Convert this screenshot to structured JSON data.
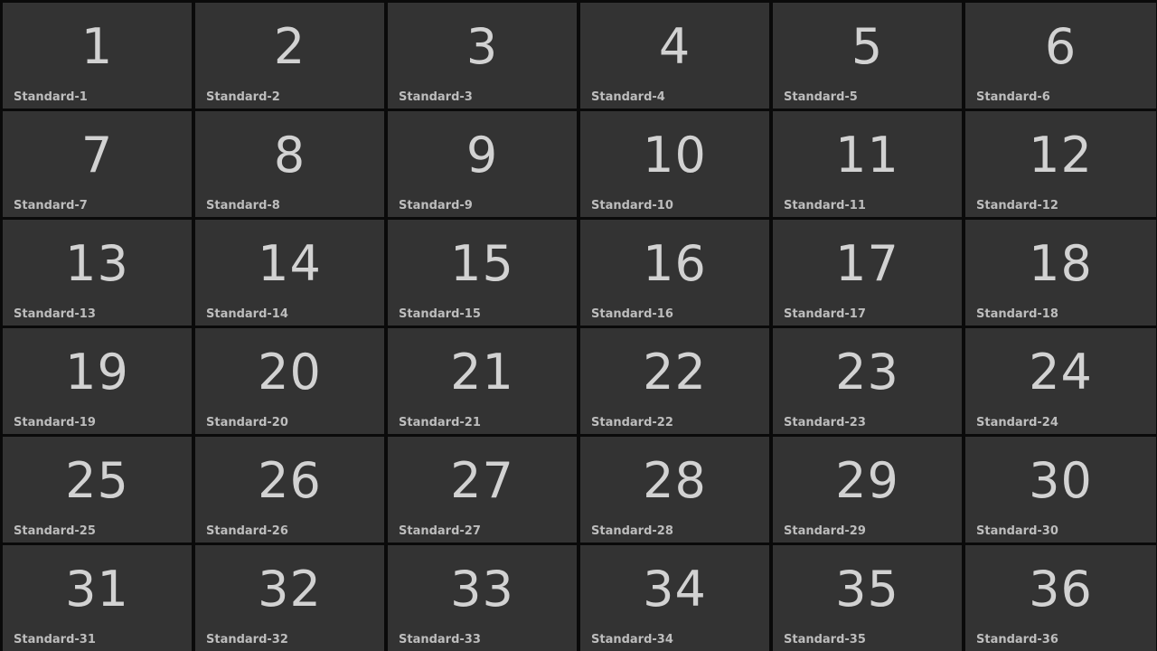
{
  "colors": {
    "background": "#0a0a0a",
    "tile": "#333333",
    "number_text": "#d2d2d2",
    "label_text": "#bdbdbd"
  },
  "tiles": [
    {
      "number": "1",
      "label": "Standard-1"
    },
    {
      "number": "2",
      "label": "Standard-2"
    },
    {
      "number": "3",
      "label": "Standard-3"
    },
    {
      "number": "4",
      "label": "Standard-4"
    },
    {
      "number": "5",
      "label": "Standard-5"
    },
    {
      "number": "6",
      "label": "Standard-6"
    },
    {
      "number": "7",
      "label": "Standard-7"
    },
    {
      "number": "8",
      "label": "Standard-8"
    },
    {
      "number": "9",
      "label": "Standard-9"
    },
    {
      "number": "10",
      "label": "Standard-10"
    },
    {
      "number": "11",
      "label": "Standard-11"
    },
    {
      "number": "12",
      "label": "Standard-12"
    },
    {
      "number": "13",
      "label": "Standard-13"
    },
    {
      "number": "14",
      "label": "Standard-14"
    },
    {
      "number": "15",
      "label": "Standard-15"
    },
    {
      "number": "16",
      "label": "Standard-16"
    },
    {
      "number": "17",
      "label": "Standard-17"
    },
    {
      "number": "18",
      "label": "Standard-18"
    },
    {
      "number": "19",
      "label": "Standard-19"
    },
    {
      "number": "20",
      "label": "Standard-20"
    },
    {
      "number": "21",
      "label": "Standard-21"
    },
    {
      "number": "22",
      "label": "Standard-22"
    },
    {
      "number": "23",
      "label": "Standard-23"
    },
    {
      "number": "24",
      "label": "Standard-24"
    },
    {
      "number": "25",
      "label": "Standard-25"
    },
    {
      "number": "26",
      "label": "Standard-26"
    },
    {
      "number": "27",
      "label": "Standard-27"
    },
    {
      "number": "28",
      "label": "Standard-28"
    },
    {
      "number": "29",
      "label": "Standard-29"
    },
    {
      "number": "30",
      "label": "Standard-30"
    },
    {
      "number": "31",
      "label": "Standard-31"
    },
    {
      "number": "32",
      "label": "Standard-32"
    },
    {
      "number": "33",
      "label": "Standard-33"
    },
    {
      "number": "34",
      "label": "Standard-34"
    },
    {
      "number": "35",
      "label": "Standard-35"
    },
    {
      "number": "36",
      "label": "Standard-36"
    }
  ]
}
